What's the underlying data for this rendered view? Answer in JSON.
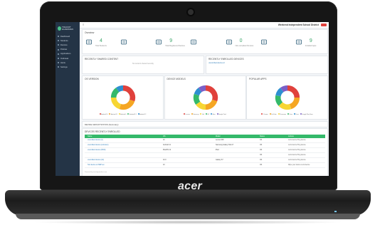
{
  "device": {
    "brand_logo": "acer"
  },
  "app": {
    "brand_name": "TRACKIT GUARDIAN",
    "menu_icon": "hamburger-icon",
    "organization_selector": "Weekend Independent School District",
    "logout_label": ""
  },
  "sidebar": {
    "items": [
      {
        "label": "Dashboard"
      },
      {
        "label": "Students"
      },
      {
        "label": "Devices"
      },
      {
        "label": "Policies"
      },
      {
        "label": "Applications"
      },
      {
        "label": "Outbreak"
      },
      {
        "label": "Alerts"
      },
      {
        "label": "Settings"
      }
    ]
  },
  "overview": {
    "title": "Overview",
    "stats": [
      {
        "icon": "students-icon",
        "value": "4",
        "label": "Total Students",
        "color": "#3aa66a"
      },
      {
        "icon": "building-icon",
        "value": "",
        "label": "",
        "color": "#3aa66a"
      },
      {
        "icon": "devices-icon",
        "value": "9",
        "label": "Total Registered Devices",
        "color": "#3aa66a"
      },
      {
        "icon": "truck-icon",
        "value": "",
        "label": "",
        "color": "#3aa66a"
      },
      {
        "icon": "alerts-icon",
        "value": "0",
        "label": "Non-compliant Devices",
        "color": "#3aa66a"
      },
      {
        "icon": "policy-icon",
        "value": "",
        "label": "",
        "color": "#3aa66a"
      },
      {
        "icon": "apps-icon",
        "value": "9",
        "unit": "Apps",
        "label": "Installed Apps",
        "color": "#3aa66a"
      }
    ]
  },
  "recent_cards": [
    {
      "title": "RECENTLY SHARED CONTENT",
      "body": "No content shared recently"
    },
    {
      "title": "RECENTLY ENROLLED DEVICES",
      "body": "unenrolled-device-id"
    }
  ],
  "charts": [
    {
      "title": "OS VERSION",
      "legend": [
        "Android 10",
        "Android 11",
        "Android 9",
        "Android 8.1",
        "Android 12"
      ]
    },
    {
      "title": "DEVICE MODELS",
      "legend": [
        "Lenovo",
        "Samsung",
        "Dell",
        "HP",
        "Acer",
        "Google Pixel"
      ]
    },
    {
      "title": "POPULAR APPS",
      "legend": [
        "Chrome",
        "YouTube",
        "Classroom",
        "Drive",
        "Docs",
        "Google Play Store"
      ]
    }
  ],
  "chart_data": [
    {
      "type": "pie",
      "title": "OS VERSION",
      "categories": [
        "Android 10",
        "Android 11",
        "Android 9",
        "Android 8.1",
        "Android 12"
      ],
      "values": [
        30,
        25,
        20,
        15,
        10
      ]
    },
    {
      "type": "pie",
      "title": "DEVICE MODELS",
      "categories": [
        "Lenovo",
        "Samsung",
        "Dell",
        "HP",
        "Acer",
        "Google Pixel"
      ],
      "values": [
        30,
        20,
        15,
        15,
        10,
        10
      ]
    },
    {
      "type": "pie",
      "title": "POPULAR APPS",
      "categories": [
        "Chrome",
        "YouTube",
        "Classroom",
        "Drive",
        "Docs",
        "Google Play Store"
      ],
      "values": [
        25,
        20,
        18,
        15,
        12,
        10
      ]
    }
  ],
  "colors": {
    "donut": [
      "#e0413c",
      "#f5a623",
      "#f7d633",
      "#34b96a",
      "#2d8fd1",
      "#7b5fc7"
    ],
    "accent": "#34b96a",
    "sidebar_bg": "#243446"
  },
  "device_groups_bar": {
    "label": "DEVICE GROUP STATUS (Summary)"
  },
  "table": {
    "title": "DEVICES RECENTLY ENROLLED",
    "headers": [
      "Name",
      "OS",
      "Model",
      "Status",
      "Actions"
    ],
    "rows": [
      {
        "name": "unenrolled device (A)",
        "os": "10",
        "model": "Lenovo M8",
        "status": "OK",
        "actions": "Lock device  Ping device"
      },
      {
        "name": "unenrolled device (unknown)",
        "os": "Android 11",
        "model": "Samsung Galaxy Tab A7",
        "status": "OK",
        "actions": "Lock device  Ping device"
      },
      {
        "name": "unenrolled device (IPAD)",
        "os": "iPadOS 14",
        "model": "iPad",
        "status": "OK",
        "actions": "Lock device  Ping device"
      },
      {
        "name": "",
        "os": "",
        "model": "",
        "status": "OK",
        "actions": "Lock device  Ping device"
      },
      {
        "name": "unenrolled device (A2)",
        "os": "10.0",
        "model": "Galaxy S7",
        "status": "OK",
        "actions": "Lock device  Ping device"
      },
      {
        "name": "Test device w/ DEP set",
        "os": "10",
        "model": "",
        "status": "OK",
        "actions": "Wipe your device  Lock device"
      }
    ],
    "footer": "Powered by trackitguardian.com"
  }
}
